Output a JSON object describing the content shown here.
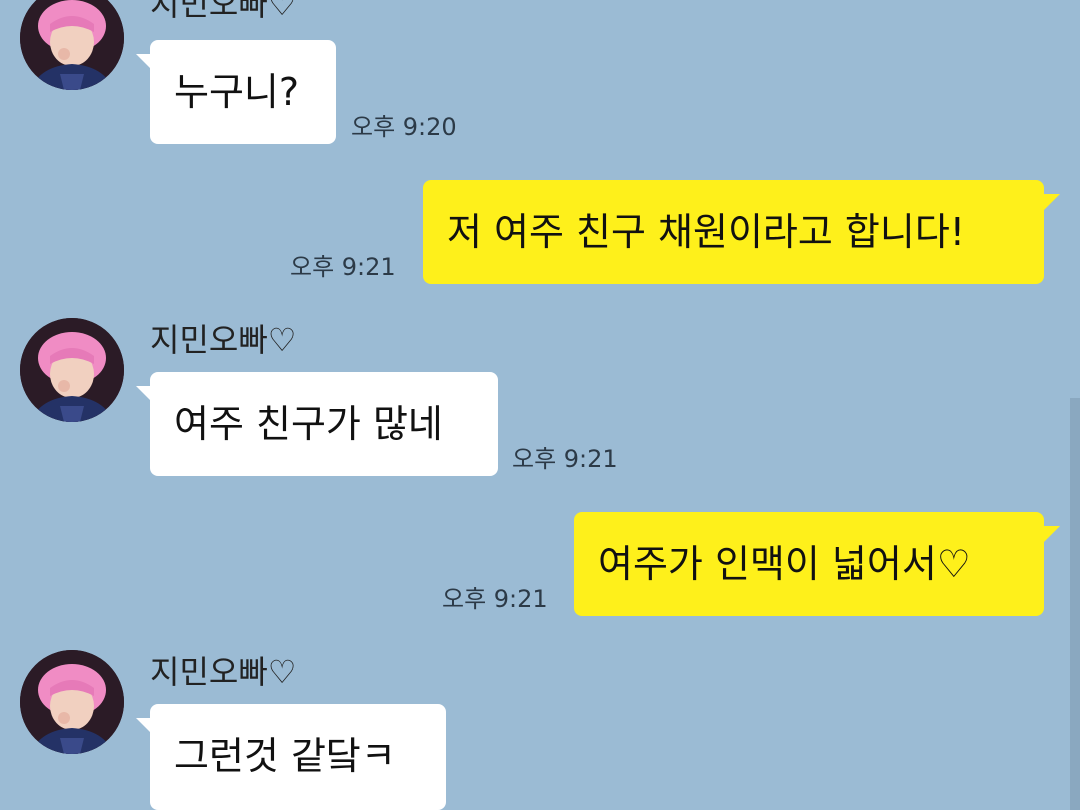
{
  "contact": {
    "name": "지민오빠♡"
  },
  "messages": [
    {
      "direction": "in",
      "text": "누구니?",
      "time": "오후 9:20"
    },
    {
      "direction": "out",
      "text": "저 여주 친구 채원이라고 합니다!",
      "time": "오후 9:21"
    },
    {
      "direction": "in",
      "text": "여주 친구가 많네",
      "time": "오후 9:21"
    },
    {
      "direction": "out",
      "text": "여주가 인맥이 넓어서♡",
      "time": "오후 9:21"
    },
    {
      "direction": "in",
      "text": "그런것 같닼ㅋ",
      "time": ""
    }
  ],
  "colors": {
    "background": "#9bbbd4",
    "incoming_bubble": "#ffffff",
    "outgoing_bubble": "#fef01b"
  },
  "icons": {
    "avatar": "profile-photo"
  }
}
